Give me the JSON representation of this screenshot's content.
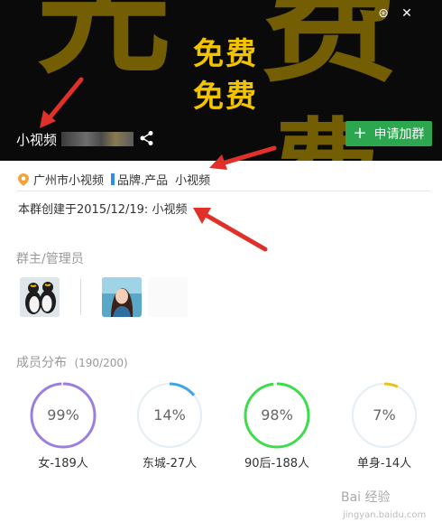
{
  "banner": {
    "bg_color": "#0a0a0a",
    "poster_lines": [
      "免费",
      "免费"
    ],
    "group_name": "小视频",
    "join_button": "申请加群",
    "accent": "#2da650"
  },
  "info": {
    "location": "广州市小视频",
    "category": "品牌.产品",
    "category_value": "小视频",
    "created_text": "本群创建于2015/12/19:  小视频"
  },
  "admins": {
    "title": "群主/管理员"
  },
  "members": {
    "title": "成员分布",
    "count": "(190/200)",
    "stats": [
      {
        "percent": "99%",
        "value": 0.99,
        "label": "女-189人",
        "color": "#9b7fe0"
      },
      {
        "percent": "14%",
        "value": 0.14,
        "label": "东城-27人",
        "color": "#3ea4ea"
      },
      {
        "percent": "98%",
        "value": 0.98,
        "label": "90后-188人",
        "color": "#3ddc4a"
      },
      {
        "percent": "7%",
        "value": 0.07,
        "label": "单身-14人",
        "color": "#e8c21a"
      }
    ]
  },
  "watermark": {
    "text": "Bai 经验",
    "sub": "jingyan.baidu.com"
  }
}
